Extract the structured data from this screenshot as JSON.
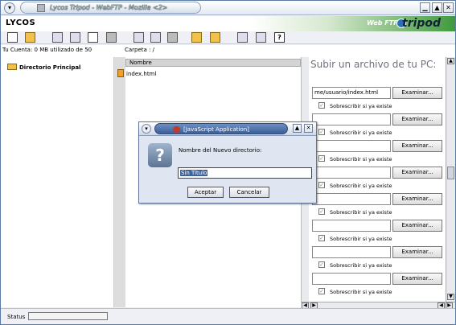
{
  "window": {
    "title": "Lycos Tripod - WebFTP - Mozilla <2>",
    "menu_glyph": "▾",
    "btn_minimize": "▁",
    "btn_maximize": "▲",
    "btn_close": "✕"
  },
  "header": {
    "lycos": "LYCOS",
    "webftp": "Web FTP",
    "tripod": "tripod"
  },
  "toolbar": {
    "icons": [
      "new-file-icon",
      "new-folder-icon",
      "add-icon",
      "move-icon",
      "view-icon",
      "edit-icon",
      "copy-icon",
      "paste-icon",
      "delete-icon",
      "folder-move-icon",
      "folder-open-icon",
      "search-icon",
      "sort-icon",
      "help-icon"
    ],
    "help_glyph": "?"
  },
  "info": {
    "account": "Tu Cuenta: 0 MB utilizado de 50",
    "folder": "Carpeta : /"
  },
  "tree": {
    "root": "Directorio Principal"
  },
  "files": {
    "column_header": "Nombre",
    "items": [
      "index.html"
    ]
  },
  "upload": {
    "title": "Subir un archivo de tu PC:",
    "first_value": "me/usuario/index.html",
    "browse_label": "Examinar...",
    "overwrite_label": "Sobrescribir si ya existe",
    "check_glyph": "✓"
  },
  "status": {
    "label": "Status"
  },
  "dialog": {
    "title": "[JavaScript Application]",
    "question_glyph": "?",
    "message": "Nombre del Nuevo directorio:",
    "input_value": "Sin Titulo",
    "accept_label": "Aceptar",
    "cancel_label": "Cancelar",
    "menu_glyph": "▾",
    "maximize_glyph": "▲",
    "close_glyph": "✕"
  }
}
